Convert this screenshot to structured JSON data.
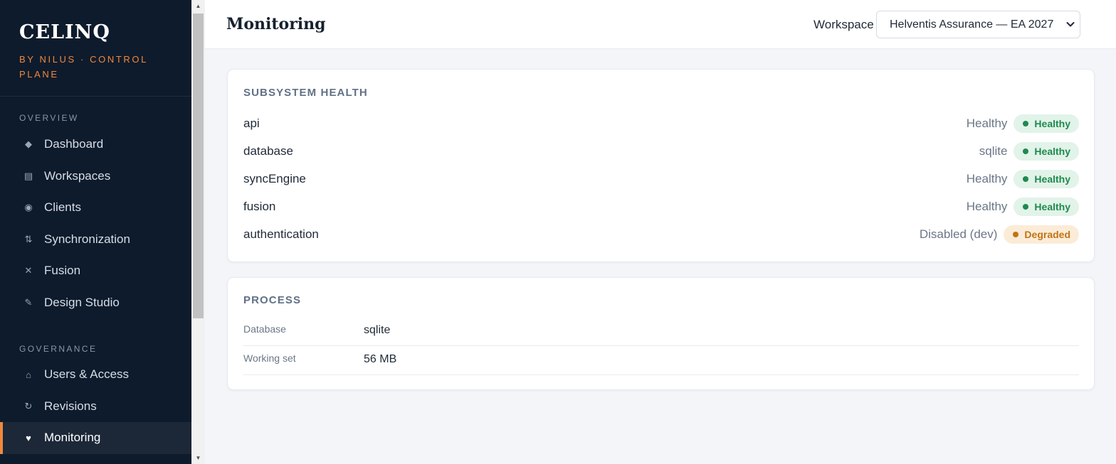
{
  "sidebar": {
    "brand": "CELINQ",
    "subtitle": "BY NILUS · CONTROL PLANE",
    "sections": [
      {
        "label": "OVERVIEW",
        "items": [
          {
            "label": "Dashboard",
            "icon": "◆"
          },
          {
            "label": "Workspaces",
            "icon": "▤"
          },
          {
            "label": "Clients",
            "icon": "◉"
          },
          {
            "label": "Synchronization",
            "icon": "⇅"
          },
          {
            "label": "Fusion",
            "icon": "✕"
          },
          {
            "label": "Design Studio",
            "icon": "✎"
          }
        ]
      },
      {
        "label": "GOVERNANCE",
        "items": [
          {
            "label": "Users & Access",
            "icon": "⌂"
          },
          {
            "label": "Revisions",
            "icon": "↻"
          },
          {
            "label": "Monitoring",
            "icon": "♥",
            "active": true
          }
        ]
      }
    ]
  },
  "header": {
    "title": "Monitoring",
    "workspace_label": "Workspace",
    "workspace_value": "Helventis Assurance — EA 2027"
  },
  "health": {
    "title": "SUBSYSTEM HEALTH",
    "rows": [
      {
        "name": "api",
        "detail": "Healthy",
        "status": "Healthy",
        "state": "ok"
      },
      {
        "name": "database",
        "detail": "sqlite",
        "status": "Healthy",
        "state": "ok"
      },
      {
        "name": "syncEngine",
        "detail": "Healthy",
        "status": "Healthy",
        "state": "ok"
      },
      {
        "name": "fusion",
        "detail": "Healthy",
        "status": "Healthy",
        "state": "ok"
      },
      {
        "name": "authentication",
        "detail": "Disabled (dev)",
        "status": "Degraded",
        "state": "warn"
      }
    ]
  },
  "process": {
    "title": "PROCESS",
    "rows": [
      {
        "key": "Database",
        "value": "sqlite"
      },
      {
        "key": "Working set",
        "value": "56 MB"
      }
    ]
  },
  "colors": {
    "sidebar_bg": "#0e1b2c",
    "accent": "#f0883e",
    "healthy": "#1e8a4e",
    "degraded": "#c27412"
  }
}
